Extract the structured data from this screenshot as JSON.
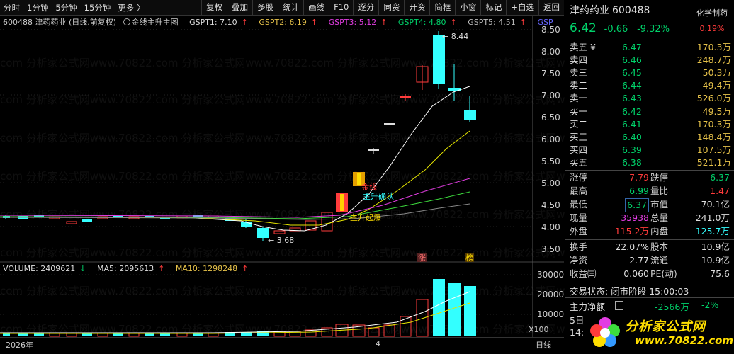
{
  "toolbar": {
    "items": [
      "分时",
      "1分钟",
      "5分钟",
      "15分钟",
      "更多 〉"
    ],
    "right_items": [
      "复权",
      "叠加",
      "多股",
      "统计",
      "画线",
      "F10",
      "逐分",
      "同资",
      "开资",
      "简框",
      "小窗",
      "标记",
      "+自选",
      "返回"
    ]
  },
  "chart_info": {
    "title": "600488 津药药业 (日线.前复权)",
    "indicator": "金线主升主图",
    "gspt1": "GSPT1: 7.10",
    "gspt2": "GSPT2: 6.19",
    "gspt3": "GSPT3: 5.12",
    "gspt4": "GSPT4: 4.80",
    "gspt5": "GSPT5: 4.51",
    "gsp6": "GSP",
    "arrow": "↑"
  },
  "annotations": {
    "high": "8.44",
    "low": "3.68",
    "jinxian": "金线",
    "zhusheng_confirm": "主升确认",
    "zhusheng_start": "主升起爆",
    "zhang": "涨",
    "bang": "榜"
  },
  "price_axis": [
    "8.50",
    "8.00",
    "7.50",
    "7.00",
    "6.50",
    "6.00",
    "5.50",
    "5.00",
    "4.50",
    "4.00",
    "3.50"
  ],
  "vol_axis": [
    "30000",
    "20000",
    "10000"
  ],
  "vol_info": {
    "volume": "VOLUME: 2409621",
    "volume_arrow": "↓",
    "ma5": "MA5: 2095613",
    "ma5_arrow": "↑",
    "ma10": "MA10: 1298248",
    "ma10_arrow": "↑"
  },
  "x100": "X100",
  "bottom": {
    "year": "2026年",
    "month": "4",
    "period": "日线"
  },
  "colors": {
    "up": "#ff3b3b",
    "down": "#3ff",
    "gold": "#e5c14a",
    "green": "#00d26a"
  },
  "panel": {
    "name": "津药药业",
    "code": "600488",
    "sector": "化学制药",
    "sector_pct": "0.19%",
    "price": "6.42",
    "change": "-0.66",
    "change_pct": "-9.32%",
    "sell": [
      {
        "label": "卖五 ¥",
        "price": "6.47",
        "vol": "170.3万"
      },
      {
        "label": "卖四",
        "price": "6.46",
        "vol": "248.7万"
      },
      {
        "label": "卖三",
        "price": "6.45",
        "vol": "50.3万"
      },
      {
        "label": "卖二",
        "price": "6.44",
        "vol": "49.4万"
      },
      {
        "label": "卖一",
        "price": "6.43",
        "vol": "526.0万"
      }
    ],
    "buy": [
      {
        "label": "买一",
        "price": "6.42",
        "vol": "49.5万"
      },
      {
        "label": "买二",
        "price": "6.41",
        "vol": "170.3万"
      },
      {
        "label": "买三",
        "price": "6.40",
        "vol": "148.4万"
      },
      {
        "label": "买四",
        "price": "6.39",
        "vol": "107.5万"
      },
      {
        "label": "买五",
        "price": "6.38",
        "vol": "521.1万"
      }
    ],
    "stats": {
      "zt_k": "涨停",
      "zt_v": "7.79",
      "dt_k": "跌停",
      "dt_v": "6.37",
      "hi_k": "最高",
      "hi_v": "6.99",
      "lb_k": "量比",
      "lb_v": "1.47",
      "lo_k": "最低",
      "lo_v": "6.37",
      "sz_k": "市值",
      "sz_v": "70.1亿",
      "xl_k": "现量",
      "xl_v": "35938",
      "zl_k": "总量",
      "zl_v": "241.0万",
      "wp_k": "外盘",
      "wp_v": "115.2万",
      "np_k": "内盘",
      "np_v": "125.7万",
      "hs_k": "换手",
      "hs_v": "22.07%",
      "gb_k": "股本",
      "gb_v": "10.9亿",
      "jz_k": "净资",
      "jz_v": "2.77",
      "lt_k": "流通",
      "lt_v": "10.9亿",
      "sy_k": "收益㈢",
      "sy_v": "0.060",
      "pe_k": "PE(动)",
      "pe_v": "75.6"
    },
    "status": "交易状态: 闭市阶段 15:00:03",
    "mainflow_label": "主力净额",
    "mainflow_value": "-2566万",
    "mainflow_pct": "-2%",
    "day5": "5日",
    "t14": "14:"
  },
  "logo": {
    "brand": "分析家公式网",
    "url": "www.70822.com"
  },
  "watermark": "com 分析家公式网www.70822.com 分析家公式网www.70822.com 分析家公式网www.70822.com 分析家公式网www.70822.com 分析家公式网www.70822."
}
